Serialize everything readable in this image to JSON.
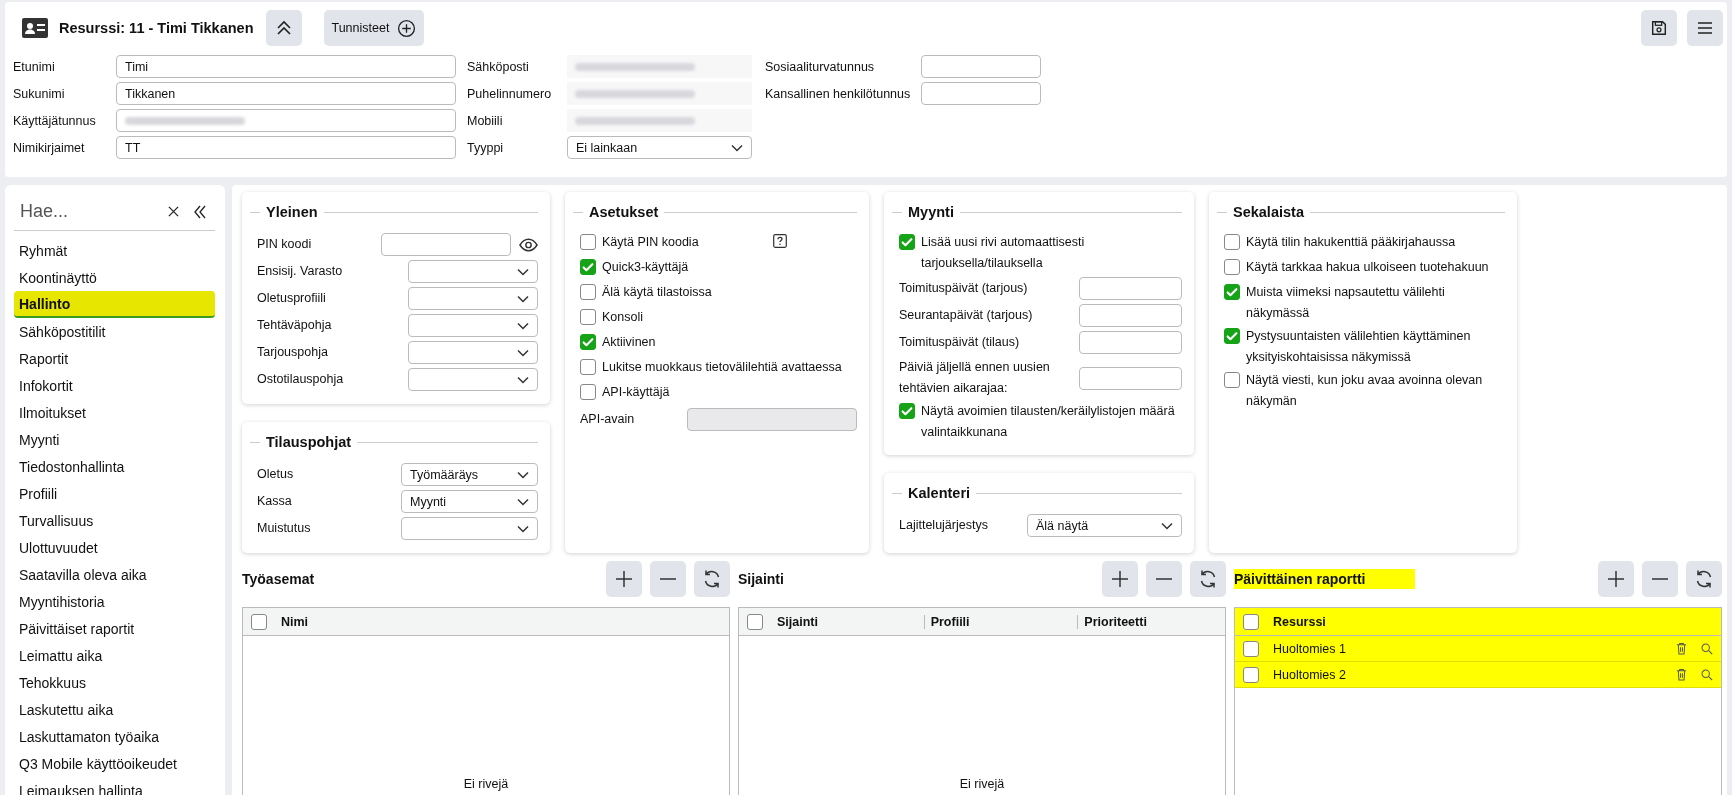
{
  "header": {
    "title": "Resurssi: 11 - Timi Tikkanen",
    "tags_button": "Tunnisteet"
  },
  "form_columns": [
    [
      {
        "label": "Etunimi",
        "kind": "input",
        "value": "Timi"
      },
      {
        "label": "Sukunimi",
        "kind": "input",
        "value": "Tikkanen"
      },
      {
        "label": "Käyttäjätunnus",
        "kind": "input_redacted"
      },
      {
        "label": "Nimikirjaimet",
        "kind": "input",
        "value": "TT"
      }
    ],
    [
      {
        "label": "Sähköposti",
        "kind": "readonly_redacted"
      },
      {
        "label": "Puhelinnumero",
        "kind": "readonly_redacted"
      },
      {
        "label": "Mobiili",
        "kind": "readonly_redacted"
      },
      {
        "label": "Tyyppi",
        "kind": "select",
        "value": "Ei lainkaan"
      }
    ],
    [
      {
        "label": "Sosiaaliturvatunnus",
        "kind": "input"
      },
      {
        "label": "Kansallinen henkilötunnus",
        "kind": "input"
      }
    ]
  ],
  "sidebar": {
    "search_placeholder": "Hae...",
    "items": [
      {
        "label": "Ryhmät",
        "selected": false
      },
      {
        "label": "Koontinäyttö",
        "selected": false
      },
      {
        "label": "Hallinto",
        "selected": true
      },
      {
        "label": "Sähköpostitilit",
        "selected": false
      },
      {
        "label": "Raportit",
        "selected": false
      },
      {
        "label": "Infokortit",
        "selected": false
      },
      {
        "label": "Ilmoitukset",
        "selected": false
      },
      {
        "label": "Myynti",
        "selected": false
      },
      {
        "label": "Tiedostonhallinta",
        "selected": false
      },
      {
        "label": "Profiili",
        "selected": false
      },
      {
        "label": "Turvallisuus",
        "selected": false
      },
      {
        "label": "Ulottuvuudet",
        "selected": false
      },
      {
        "label": "Saatavilla oleva aika",
        "selected": false
      },
      {
        "label": "Myyntihistoria",
        "selected": false
      },
      {
        "label": "Päivittäiset raportit",
        "selected": false
      },
      {
        "label": "Leimattu aika",
        "selected": false
      },
      {
        "label": "Tehokkuus",
        "selected": false
      },
      {
        "label": "Laskutettu aika",
        "selected": false
      },
      {
        "label": "Laskuttamaton työaika",
        "selected": false
      },
      {
        "label": "Q3 Mobile käyttöoikeudet",
        "selected": false
      },
      {
        "label": "Leimauksen hallinta",
        "selected": false
      }
    ]
  },
  "panel_columns": [
    [
      {
        "title": "Yleinen",
        "rows": [
          {
            "kind": "password",
            "label": "PIN koodi"
          },
          {
            "kind": "select",
            "label": "Ensisij. Varasto"
          },
          {
            "kind": "select",
            "label": "Oletusprofiili"
          },
          {
            "kind": "select",
            "label": "Tehtäväpohja"
          },
          {
            "kind": "select",
            "label": "Tarjouspohja"
          },
          {
            "kind": "select",
            "label": "Ostotilauspohja"
          }
        ]
      },
      {
        "title": "Tilauspohjat",
        "rows": [
          {
            "kind": "select",
            "label": "Oletus",
            "value": "Työmääräys"
          },
          {
            "kind": "select",
            "label": "Kassa",
            "value": "Myynti"
          },
          {
            "kind": "select",
            "label": "Muistutus"
          }
        ]
      }
    ],
    [
      {
        "title": "Asetukset",
        "rows": [
          {
            "kind": "checkbox",
            "label": "Käytä PIN koodia",
            "checked": false,
            "help": true
          },
          {
            "kind": "checkbox",
            "label": "Quick3-käyttäjä",
            "checked": true,
            "help": false
          },
          {
            "kind": "checkbox",
            "label": "Älä käytä tilastoissa",
            "checked": false,
            "help": false
          },
          {
            "kind": "checkbox",
            "label": "Konsoli",
            "checked": false,
            "help": false
          },
          {
            "kind": "checkbox",
            "label": "Aktiivinen",
            "checked": true,
            "help": false
          },
          {
            "kind": "checkbox",
            "label": "Lukitse muokkaus tietovälilehtiä avattaessa",
            "checked": false,
            "help": false
          },
          {
            "kind": "checkbox",
            "label": "API-käyttäjä",
            "checked": false,
            "help": false
          },
          {
            "kind": "input",
            "label": "API-avain",
            "disabled": true
          }
        ]
      }
    ],
    [
      {
        "title": "Myynti",
        "rows": [
          {
            "kind": "checkbox",
            "label": "Lisää uusi rivi automaattisesti tarjouksella/tilauksella",
            "checked": true,
            "help": false
          },
          {
            "kind": "input",
            "label": "Toimituspäivät (tarjous)",
            "disabled": false
          },
          {
            "kind": "input",
            "label": "Seurantapäivät (tarjous)",
            "disabled": false
          },
          {
            "kind": "input",
            "label": "Toimituspäivät (tilaus)",
            "disabled": false
          },
          {
            "kind": "input",
            "label": "Päiviä jäljellä ennen uusien tehtävien aikarajaa:",
            "disabled": false
          },
          {
            "kind": "checkbox",
            "label": "Näytä avoimien tilausten/keräilylistojen määrä valintaikkunana",
            "checked": true,
            "help": false
          }
        ]
      },
      {
        "title": "Kalenteri",
        "rows": [
          {
            "kind": "select",
            "label": "Lajittelujärjestys",
            "value": "Älä näytä"
          }
        ]
      }
    ],
    [
      {
        "title": "Sekalaista",
        "rows": [
          {
            "kind": "checkbox",
            "label": "Käytä tilin hakukenttiä pääkirjahaussa",
            "checked": false,
            "help": false
          },
          {
            "kind": "checkbox",
            "label": "Käytä tarkkaa hakua ulkoiseen tuotehakuun",
            "checked": false,
            "help": false
          },
          {
            "kind": "checkbox",
            "label": "Muista viimeksi napsautettu välilehti näkymässä",
            "checked": true,
            "help": false
          },
          {
            "kind": "checkbox",
            "label": "Pystysuuntaisten välilehtien käyttäminen yksityiskohtaisissa näkymissä",
            "checked": true,
            "help": false
          },
          {
            "kind": "checkbox",
            "label": "Näytä viesti, kun joku avaa avoinna olevan näkymän",
            "checked": false,
            "help": false
          }
        ]
      }
    ]
  ],
  "tables": [
    {
      "title": "Työasemat",
      "highlighted": false,
      "header_checked": false,
      "columns": [
        "Nimi"
      ],
      "empty_text": "Ei rivejä"
    },
    {
      "title": "Sijainti",
      "highlighted": false,
      "header_checked": false,
      "columns": [
        "Sijainti",
        "Profiili",
        "Prioriteetti"
      ],
      "empty_text": "Ei rivejä"
    },
    {
      "title": "Päivittäinen raportti",
      "highlighted": true,
      "header_checked": false,
      "columns": [
        "Resurssi"
      ],
      "rows": [
        {
          "cells": [
            "Huoltomies 1"
          ],
          "checked": false
        },
        {
          "cells": [
            "Huoltomies 2"
          ],
          "checked": false
        }
      ]
    }
  ]
}
